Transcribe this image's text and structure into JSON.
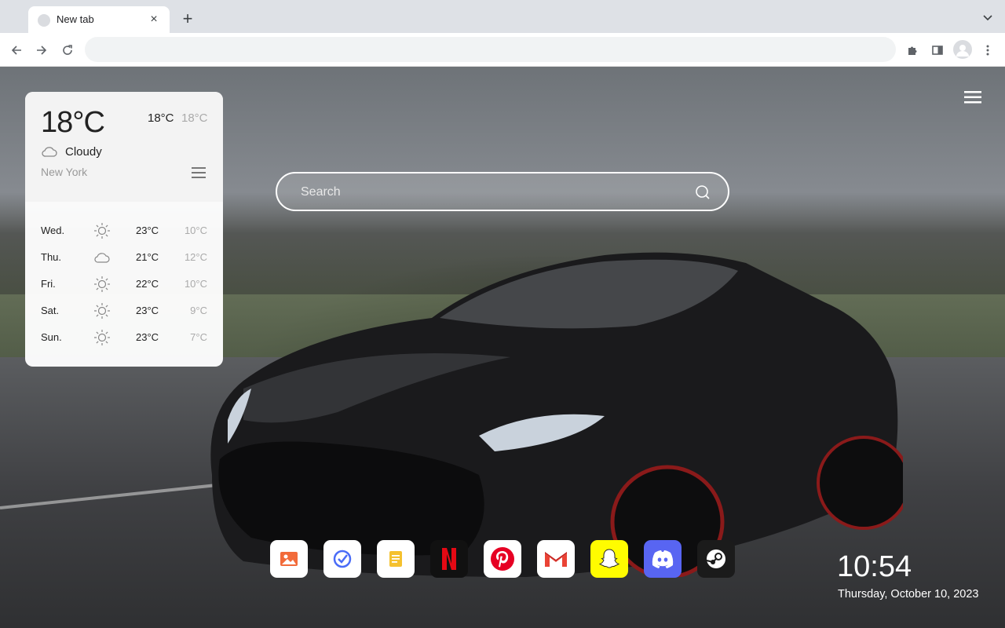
{
  "browser": {
    "tab_title": "New tab",
    "tab_close": "×",
    "new_tab": "+",
    "address": "",
    "address_placeholder": ""
  },
  "weather": {
    "current_temp": "18°C",
    "today_high": "18°C",
    "today_low": "18°C",
    "condition": "Cloudy",
    "condition_icon": "cloud-icon",
    "city": "New York",
    "forecast": [
      {
        "day": "Wed.",
        "icon": "sun-icon",
        "high": "23°C",
        "low": "10°C"
      },
      {
        "day": "Thu.",
        "icon": "cloud-icon",
        "high": "21°C",
        "low": "12°C"
      },
      {
        "day": "Fri.",
        "icon": "sun-icon",
        "high": "22°C",
        "low": "10°C"
      },
      {
        "day": "Sat.",
        "icon": "sun-icon",
        "high": "23°C",
        "low": "9°C"
      },
      {
        "day": "Sun.",
        "icon": "sun-icon",
        "high": "23°C",
        "low": "7°C"
      }
    ]
  },
  "search": {
    "placeholder": "Search"
  },
  "dock": [
    {
      "name": "photos-app",
      "icon": "image-icon",
      "color": "#ffffff"
    },
    {
      "name": "tasks-app",
      "icon": "check-circle-icon",
      "color": "#ffffff"
    },
    {
      "name": "notes-app",
      "icon": "note-icon",
      "color": "#ffffff"
    },
    {
      "name": "netflix-app",
      "icon": "netflix-icon",
      "color": "#111111"
    },
    {
      "name": "pinterest-app",
      "icon": "pinterest-icon",
      "color": "#ffffff"
    },
    {
      "name": "gmail-app",
      "icon": "gmail-icon",
      "color": "#ffffff"
    },
    {
      "name": "snapchat-app",
      "icon": "snapchat-icon",
      "color": "#fffc00"
    },
    {
      "name": "discord-app",
      "icon": "discord-icon",
      "color": "#5865f2"
    },
    {
      "name": "steam-app",
      "icon": "steam-icon",
      "color": "#1b1b1b"
    }
  ],
  "clock": {
    "time": "10:54",
    "date": "Thursday, October 10, 2023"
  }
}
